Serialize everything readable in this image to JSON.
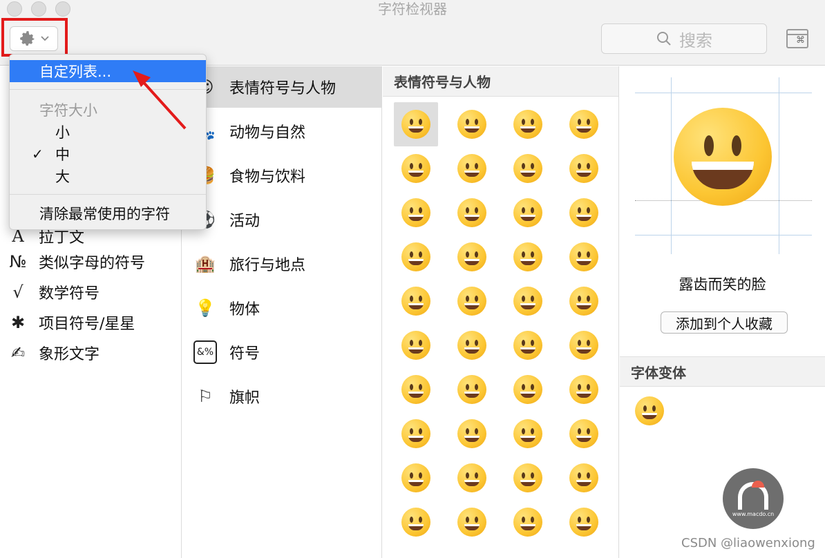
{
  "window": {
    "title": "字符检视器"
  },
  "toolbar": {
    "gear_icon": "gear-icon",
    "search_placeholder": "搜索"
  },
  "categories_col1": [
    {
      "icon": "A",
      "label": "拉丁文"
    },
    {
      "icon": "№",
      "label": "类似字母的符号"
    },
    {
      "icon": "√",
      "label": "数学符号"
    },
    {
      "icon": "✱",
      "label": "项目符号/星星"
    },
    {
      "icon": "✍",
      "label": "象形文字"
    }
  ],
  "categories_col2": [
    {
      "icon": "☺",
      "label": "表情符号与人物",
      "selected": true
    },
    {
      "icon": "🐾",
      "label": "动物与自然"
    },
    {
      "icon": "🍔",
      "label": "食物与饮料"
    },
    {
      "icon": "⚽",
      "label": "活动"
    },
    {
      "icon": "🏨",
      "label": "旅行与地点"
    },
    {
      "icon": "💡",
      "label": "物体"
    },
    {
      "icon": "&%",
      "label": "符号"
    },
    {
      "icon": "⚐",
      "label": "旗帜"
    }
  ],
  "emoji_panel": {
    "header": "表情符号与人物",
    "rows": 10,
    "cols": 4
  },
  "detail": {
    "char_name": "露齿而笑的脸",
    "add_favorite_label": "添加到个人收藏",
    "font_variants_header": "字体变体"
  },
  "menu": {
    "customize_list": "自定列表...",
    "char_size_label": "字符大小",
    "size_small": "小",
    "size_medium": "中",
    "size_large": "大",
    "checkmark": "✓",
    "clear_recent": "清除最常使用的字符"
  },
  "watermark": {
    "url": "www.macdo.cn",
    "credit": "CSDN @liaowenxiong"
  },
  "colors": {
    "highlight": "#2f7cf6",
    "annotation": "#e31b1b"
  }
}
